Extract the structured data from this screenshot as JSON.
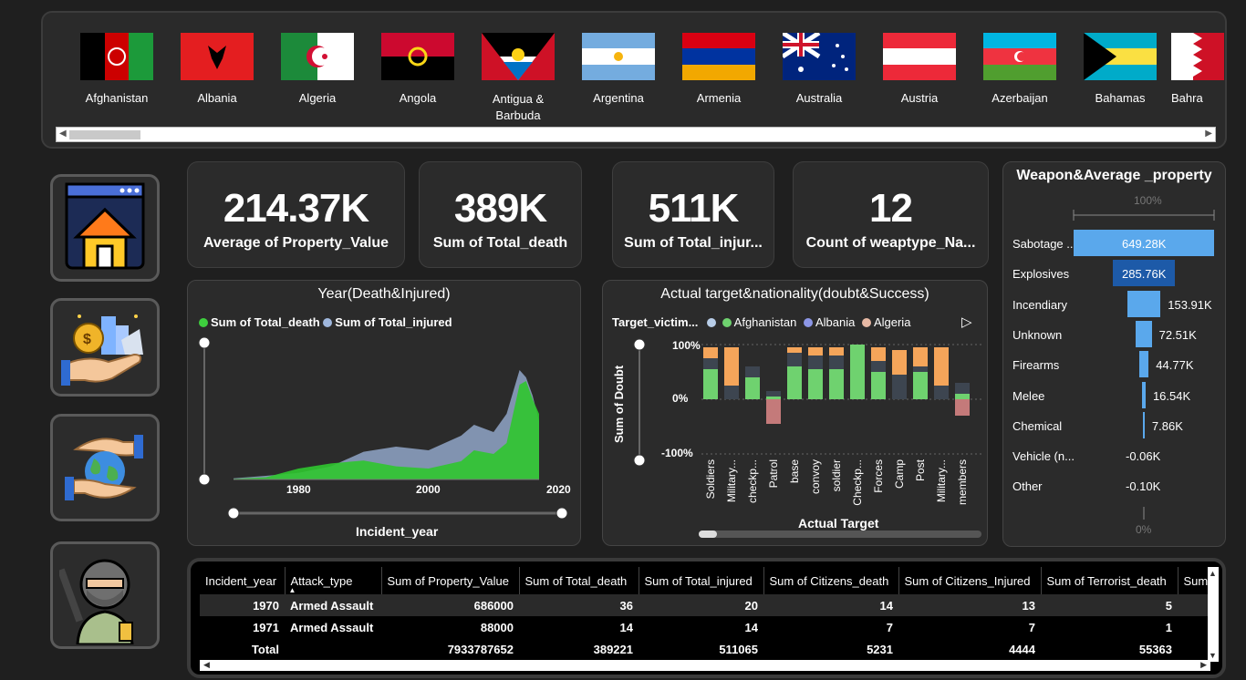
{
  "flags": [
    {
      "name": "Afghanistan",
      "icon": "afghanistan-flag-icon"
    },
    {
      "name": "Albania",
      "icon": "albania-flag-icon"
    },
    {
      "name": "Algeria",
      "icon": "algeria-flag-icon"
    },
    {
      "name": "Angola",
      "icon": "angola-flag-icon"
    },
    {
      "name": "Antigua & Barbuda",
      "icon": "antigua-flag-icon"
    },
    {
      "name": "Argentina",
      "icon": "argentina-flag-icon"
    },
    {
      "name": "Armenia",
      "icon": "armenia-flag-icon"
    },
    {
      "name": "Australia",
      "icon": "australia-flag-icon"
    },
    {
      "name": "Austria",
      "icon": "austria-flag-icon"
    },
    {
      "name": "Azerbaijan",
      "icon": "azerbaijan-flag-icon"
    },
    {
      "name": "Bahamas",
      "icon": "bahamas-flag-icon"
    },
    {
      "name": "Bahrain",
      "icon": "bahrain-flag-icon"
    }
  ],
  "flag_label_last": "Bahra",
  "nav": [
    "home-icon",
    "property-icon",
    "world-icon",
    "soldier-icon"
  ],
  "kpis": [
    {
      "value": "214.37K",
      "label": "Average of Property_Value"
    },
    {
      "value": "389K",
      "label": "Sum of Total_death"
    },
    {
      "value": "511K",
      "label": "Sum of Total_injur..."
    },
    {
      "value": "12",
      "label": "Count of weaptype_Na..."
    }
  ],
  "year_chart": {
    "title": "Year(Death&Injured)",
    "legend": [
      "Sum of Total_death",
      "Sum of Total_injured"
    ],
    "xlabel": "Incident_year",
    "ticks": [
      "1980",
      "2000",
      "2020"
    ]
  },
  "target_chart": {
    "title": "Actual target&nationality(doubt&Success)",
    "legend_title": "Target_victim...",
    "legend": [
      "Afghanistan",
      "Albania",
      "Algeria"
    ],
    "ylabel": "Sum of Doubt",
    "xlabel": "Actual Target",
    "yticks": [
      "100%",
      "0%",
      "-100%"
    ],
    "categories": [
      "Soldiers",
      "Military...",
      "checkp...",
      "Patrol",
      "base",
      "convoy",
      "soldier",
      "Checkp...",
      "Forces",
      "Camp",
      "Post",
      "Military...",
      "members"
    ]
  },
  "weapon_chart": {
    "title": "Weapon&Average _property",
    "top_pct": "100%",
    "bottom_pct": "0%",
    "rows": [
      {
        "label": "Sabotage ...",
        "value": "649.28K",
        "num": 649.28
      },
      {
        "label": "Explosives",
        "value": "285.76K",
        "num": 285.76
      },
      {
        "label": "Incendiary",
        "value": "153.91K",
        "num": 153.91
      },
      {
        "label": "Unknown",
        "value": "72.51K",
        "num": 72.51
      },
      {
        "label": "Firearms",
        "value": "44.77K",
        "num": 44.77
      },
      {
        "label": "Melee",
        "value": "16.54K",
        "num": 16.54
      },
      {
        "label": "Chemical",
        "value": "7.86K",
        "num": 7.86
      },
      {
        "label": "Vehicle (n...",
        "value": "-0.06K",
        "num": -0.06
      },
      {
        "label": "Other",
        "value": "-0.10K",
        "num": -0.1
      }
    ]
  },
  "table": {
    "headers": [
      "Incident_year",
      "Attack_type",
      "Sum of Property_Value",
      "Sum of Total_death",
      "Sum of Total_injured",
      "Sum of Citizens_death",
      "Sum of Citizens_Injured",
      "Sum of Terrorist_death",
      "Sum"
    ],
    "rows": [
      [
        "1970",
        "Armed Assault",
        "686000",
        "36",
        "20",
        "14",
        "13",
        "5"
      ],
      [
        "1971",
        "Armed Assault",
        "88000",
        "14",
        "14",
        "7",
        "7",
        "1"
      ]
    ],
    "total": [
      "Total",
      "",
      "7933787652",
      "389221",
      "511065",
      "5231",
      "4444",
      "55363"
    ]
  },
  "chart_data": [
    {
      "type": "area",
      "title": "Year(Death&Injured)",
      "xlabel": "Incident_year",
      "xlim": [
        1970,
        2017
      ],
      "series": [
        {
          "name": "Sum of Total_death",
          "x": [
            1970,
            1975,
            1980,
            1985,
            1990,
            1995,
            2000,
            2005,
            2007,
            2010,
            2012,
            2014,
            2015,
            2016,
            2017
          ],
          "values": [
            100,
            300,
            1500,
            2200,
            2600,
            1800,
            1500,
            2500,
            4000,
            3500,
            5000,
            13000,
            13500,
            11000,
            9000
          ]
        },
        {
          "name": "Sum of Total_injured",
          "x": [
            1970,
            1975,
            1980,
            1985,
            1990,
            1995,
            2000,
            2005,
            2007,
            2010,
            2012,
            2014,
            2015,
            2016,
            2017
          ],
          "values": [
            150,
            500,
            900,
            1800,
            3800,
            4500,
            4000,
            6000,
            7500,
            6500,
            9000,
            15000,
            14000,
            11500,
            8000
          ]
        }
      ]
    },
    {
      "type": "bar",
      "title": "Actual target&nationality(doubt&Success)",
      "ylabel": "Sum of Doubt",
      "xlabel": "Actual Target",
      "ylim": [
        -100,
        100
      ],
      "categories": [
        "Soldiers",
        "Military...",
        "checkp...",
        "Patrol",
        "base",
        "convoy",
        "soldier",
        "Checkp...",
        "Forces",
        "Camp",
        "Post",
        "Military...",
        "members"
      ],
      "series": [
        {
          "name": "Afghanistan",
          "values": [
            55,
            0,
            40,
            5,
            60,
            55,
            55,
            100,
            50,
            0,
            50,
            0,
            10
          ]
        },
        {
          "name": "Albania",
          "values": [
            20,
            25,
            20,
            10,
            25,
            25,
            25,
            0,
            20,
            45,
            10,
            25,
            20
          ]
        },
        {
          "name": "Algeria",
          "values": [
            20,
            70,
            0,
            -45,
            10,
            15,
            15,
            0,
            25,
            45,
            35,
            70,
            -30
          ]
        }
      ]
    },
    {
      "type": "bar",
      "title": "Weapon&Average _property",
      "categories": [
        "Sabotage ...",
        "Explosives",
        "Incendiary",
        "Unknown",
        "Firearms",
        "Melee",
        "Chemical",
        "Vehicle (n...",
        "Other"
      ],
      "values": [
        649.28,
        285.76,
        153.91,
        72.51,
        44.77,
        16.54,
        7.86,
        -0.06,
        -0.1
      ]
    }
  ]
}
